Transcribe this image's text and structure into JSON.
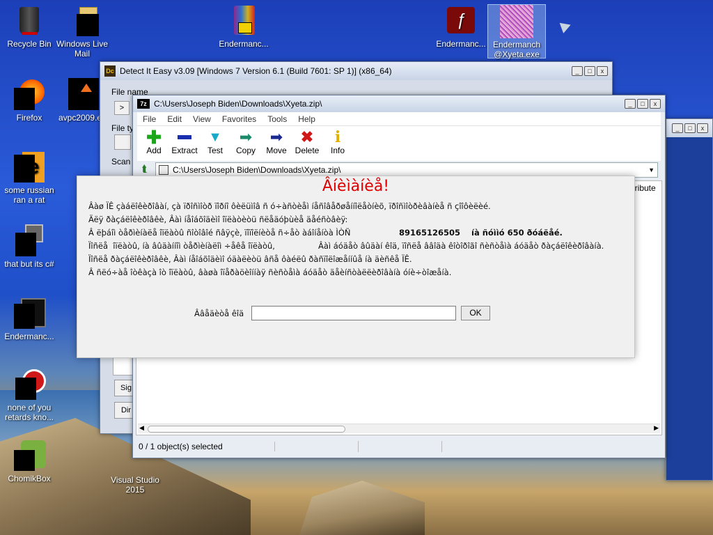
{
  "desktop": {
    "icons": [
      {
        "label": "Recycle Bin"
      },
      {
        "label": "Windows Live Mail"
      },
      {
        "label": "Endermanc..."
      },
      {
        "label": "Endermanc..."
      },
      {
        "label": "Endermanch @Xyeta.exe"
      },
      {
        "label": "Firefox"
      },
      {
        "label": "avpc2009.ex"
      },
      {
        "label": "some russian ran a rat"
      },
      {
        "label": "that but its c#"
      },
      {
        "label": "Endermanc..."
      },
      {
        "label": "none of you retards kno..."
      },
      {
        "label": "ChomikBox"
      },
      {
        "label": "Visual Studio 2015"
      }
    ]
  },
  "die": {
    "title": "Detect It Easy v3.09 [Windows 7 Version 6.1 (Build 7601: SP 1)] (x86_64)",
    "file_name_label": "File name",
    "file_type_label": "File ty",
    "scan_label": "Scan",
    "browse_label": ">",
    "sig_label": "Sig",
    "dir_label": "Dir"
  },
  "sevenzip": {
    "title": "C:\\Users\\Joseph Biden\\Downloads\\Xyeta.zip\\",
    "menu": [
      "File",
      "Edit",
      "View",
      "Favorites",
      "Tools",
      "Help"
    ],
    "tools": [
      {
        "label": "Add",
        "icon": "plus-icon",
        "color": "#1aa81a"
      },
      {
        "label": "Extract",
        "icon": "minus-icon",
        "color": "#1a2fb0"
      },
      {
        "label": "Test",
        "icon": "check-icon",
        "color": "#18a8c8"
      },
      {
        "label": "Copy",
        "icon": "copy-arrow-icon",
        "color": "#1a8a6a"
      },
      {
        "label": "Move",
        "icon": "move-arrow-icon",
        "color": "#1a2a90"
      },
      {
        "label": "Delete",
        "icon": "delete-x-icon",
        "color": "#d01818"
      },
      {
        "label": "Info",
        "icon": "info-icon",
        "color": "#e0b000"
      }
    ],
    "address": "C:\\Users\\Joseph Biden\\Downloads\\Xyeta.zip\\",
    "column_partial": "ttribute",
    "status": "0 / 1 object(s) selected"
  },
  "ransom": {
    "title": "Âíèìàíèå!",
    "lines": [
      "Âàø ÏÊ çàáëîêèðîâàí, çà ïðîñìîòð ïîðíî ôèëüìîâ ñ ó÷àñòèåì íåñîâåðøåííîëåòíèõ, ïðîñìîòðèâàíèå ñ çîîôèëèé.",
      "Äëÿ ðàçáëîêèðîâêè, Âàì íåîáõîäèìî îïëàòèòü ñëåäóþùèå äåéñòâèÿ:",
      "Â ëþáîì òåðìèíàëå îïëàòû ñîòîâîé ñâÿçè, ïîïîëíèòå ñ÷åò àáîíåíòà ÌÒÑ",
      "Ïîñëå  îïëàòû, íà âûäàííîì òåðìèíàëîì ÷åêå îïëàòû,",
      "Ïîñëå ðàçáëîêèðîâêè, Âàì íåîáõîäèìî óäàëèòü âñå ôàéëû ðàñïîëîæåííûå íà äèñêå ÏÊ.",
      "Â ñëó÷àå îòêàçà îò îïëàòû, âàøà îïåðàöèîííàÿ ñèñòåìà áóäåò äåèíñòàëëèðîâàíà óíè÷òîæåíà."
    ],
    "phone": "89165126505",
    "amount": "íà ñóììó 650 ðóáëåé.",
    "line4_right": "Âàì áóäåò âûäàí êîä, ïîñëå ââîäà êîòîðîãî ñèñòåìà áóäåò ðàçáëîêèðîâàíà.",
    "input_label": "Ââåäèòå êîä",
    "input_value": "",
    "ok_label": "OK"
  }
}
